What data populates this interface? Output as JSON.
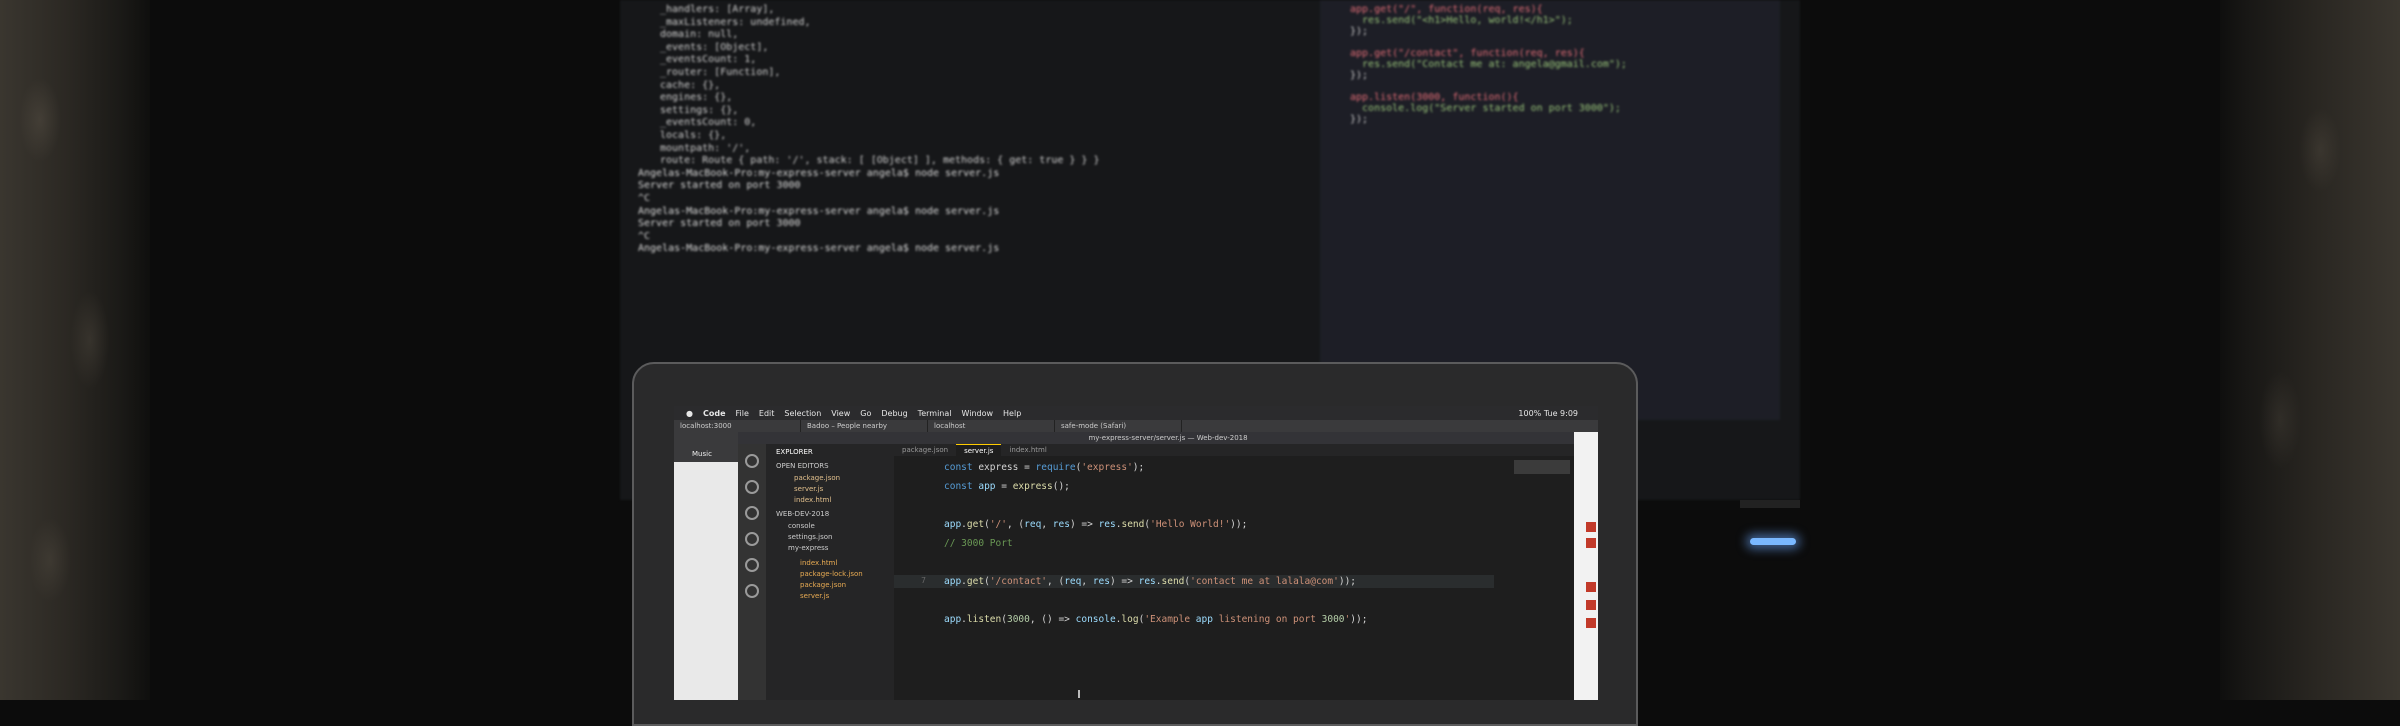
{
  "scene": "Photo of a laptop showing VS Code in front of a blurred external monitor with terminal and editor",
  "laptop": {
    "menubar": [
      "Code",
      "File",
      "Edit",
      "Selection",
      "View",
      "Go",
      "Debug",
      "Terminal",
      "Window",
      "Help"
    ],
    "menubar_right": "100% Tue 9:09",
    "browser_tabs": [
      "localhost:3000",
      "Badoo – People nearby",
      "localhost",
      "safe-mode (Safari)"
    ],
    "window_title": "my-express-server/server.js — Web-dev-2018",
    "editor_tabs": [
      "package.json",
      "server.js",
      "index.html"
    ],
    "explorer": {
      "header": "EXPLORER",
      "open_editors": "OPEN EDITORS",
      "open_files": [
        "package.json",
        "server.js",
        "index.html"
      ],
      "workspace": "WEB-DEV-2018",
      "folders": [
        "console",
        "settings.json",
        "my-express"
      ],
      "files": [
        "index.html",
        "package-lock.json",
        "package.json",
        "server.js"
      ]
    },
    "code_lines": [
      {
        "n": "",
        "t": "const express = require('express');"
      },
      {
        "n": "",
        "t": "const app = express();"
      },
      {
        "n": "",
        "t": ""
      },
      {
        "n": "",
        "t": "app.get('/', (req, res) => res.send('Hello World!'));"
      },
      {
        "n": "",
        "t": "// 3000 Port"
      },
      {
        "n": "",
        "t": ""
      },
      {
        "n": "7",
        "t": "app.get('/contact', (req, res) => res.send('contact me at lalala@com'));"
      },
      {
        "n": "",
        "t": ""
      },
      {
        "n": "",
        "t": "app.listen(3000, () => console.log('Example app listening on port 3000'));"
      }
    ],
    "browser_sidebar_label": "Music"
  },
  "monitor": {
    "terminal_lines": [
      "_handlers: [Array],",
      "_maxListeners: undefined,",
      "domain: null,",
      "_events: [Object],",
      "_eventsCount: 1,",
      "_router: [Function],",
      "cache: {},",
      "engines: {},",
      "settings: {},",
      "_eventsCount: 0,",
      "locals: {},",
      "mountpath: '/',",
      "route: Route { path: '/', stack: [ [Object] ], methods: { get: true } } }",
      "Angelas-MacBook-Pro:my-express-server angela$ node server.js",
      "Server started on port 3000",
      "^C",
      "Angelas-MacBook-Pro:my-express-server angela$ node server.js",
      "Server started on port 3000",
      "^C",
      "Angelas-MacBook-Pro:my-express-server angela$ node server.js"
    ],
    "editor_lines": [
      "app.get(\"/\", function(req, res){",
      "  res.send(\"<h1>Hello, world!</h1>\");",
      "});",
      "",
      "app.get(\"/contact\", function(req, res){",
      "  res.send(\"Contact me at: angela@gmail.com\");",
      "});",
      "",
      "app.listen(3000, function(){",
      "  console.log(\"Server started on port 3000\");",
      "});"
    ]
  }
}
